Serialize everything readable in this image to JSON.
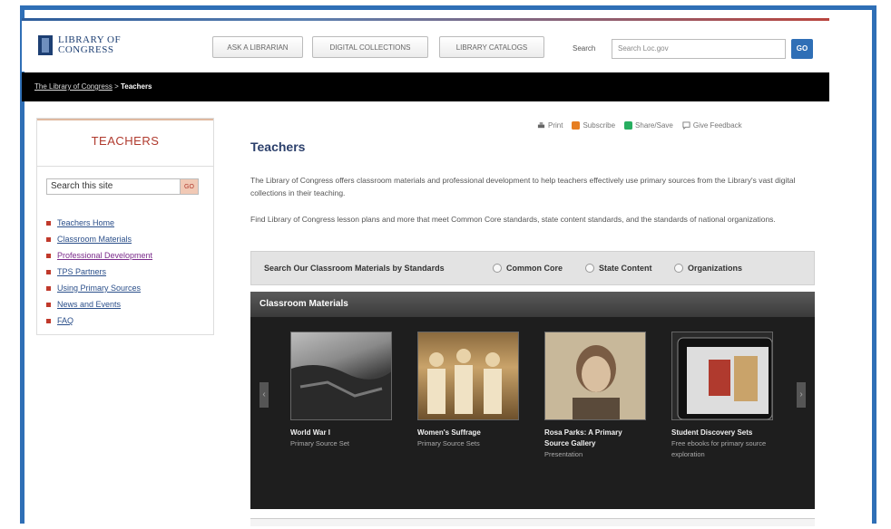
{
  "header": {
    "logo_line1": "LIBRARY OF",
    "logo_line2": "CONGRESS",
    "nav": [
      "ASK A LIBRARIAN",
      "DIGITAL COLLECTIONS",
      "LIBRARY CATALOGS"
    ],
    "search_label": "Search",
    "search_placeholder": "Search Loc.gov",
    "go_label": "GO"
  },
  "breadcrumb": {
    "home": "The Library of Congress",
    "separator": ">",
    "current": "Teachers"
  },
  "sidebar": {
    "title": "TEACHERS",
    "search_value": "Search this site",
    "go_label": "GO",
    "items": [
      {
        "label": "Teachers Home",
        "visited": false
      },
      {
        "label": "Classroom Materials",
        "visited": false
      },
      {
        "label": "Professional Development",
        "visited": true
      },
      {
        "label": "TPS Partners",
        "visited": false
      },
      {
        "label": "Using Primary Sources",
        "visited": false
      },
      {
        "label": "News and Events",
        "visited": false
      },
      {
        "label": "FAQ",
        "visited": false
      }
    ]
  },
  "tools": {
    "print": "Print",
    "subscribe": "Subscribe",
    "share": "Share/Save",
    "feedback": "Give Feedback"
  },
  "main": {
    "title": "Teachers",
    "para1": "The Library of Congress offers classroom materials and professional development to help teachers effectively use primary sources from the Library's vast digital collections in their teaching.",
    "para2": "Find Library of Congress lesson plans and more that meet Common Core standards, state content standards, and the standards of national organizations."
  },
  "standards": {
    "label": "Search Our Classroom Materials by Standards",
    "options": [
      "Common Core",
      "State Content",
      "Organizations"
    ]
  },
  "carousel": {
    "heading": "Classroom Materials",
    "items": [
      {
        "title": "World War I",
        "subtitle": "Primary Source Set"
      },
      {
        "title": "Women's Suffrage",
        "subtitle": "Primary Source Sets"
      },
      {
        "title": "Rosa Parks: A Primary Source Gallery",
        "subtitle": "Presentation"
      },
      {
        "title": "Student Discovery Sets",
        "subtitle": "Free ebooks for primary source exploration"
      }
    ]
  },
  "colors": {
    "frame_border": "#2f6fb6",
    "accent_red": "#b03a2e",
    "nav_dark": "#000000",
    "title_blue": "#2b3f6b"
  }
}
